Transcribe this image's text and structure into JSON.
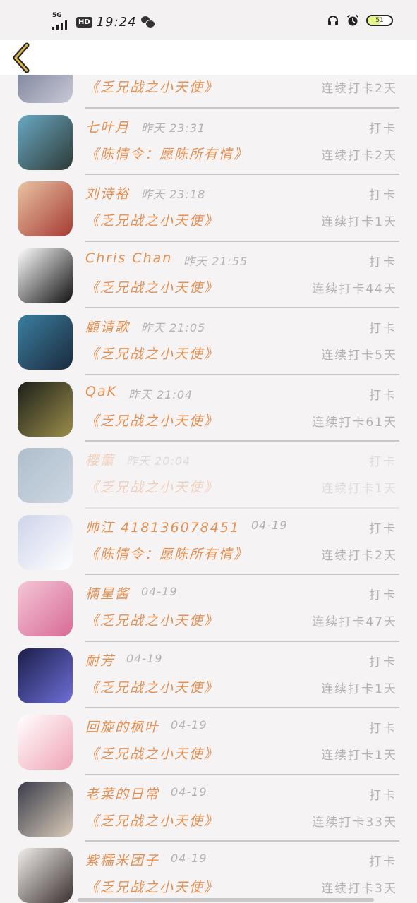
{
  "status_bar": {
    "network": "5G",
    "hd": "HD",
    "time": "19:24",
    "battery": "51",
    "battery_level": 0.51
  },
  "header": {
    "back_icon": "chevron-left-icon",
    "accent": "#d8b24a"
  },
  "rows": [
    {
      "name": "",
      "time": "",
      "action": "",
      "book": "《乏兄战之小天使》",
      "streak": "连续打卡2天",
      "avatar_colors": [
        "#6e7690",
        "#c8c9d6"
      ]
    },
    {
      "name": "七叶月",
      "time": "昨天 23:31",
      "action": "打卡",
      "book": "《陈情令：愿陈所有情》",
      "streak": "连续打卡2天",
      "avatar_colors": [
        "#6aa9c4",
        "#2d3a36"
      ]
    },
    {
      "name": "刘诗裕",
      "time": "昨天 23:18",
      "action": "打卡",
      "book": "《乏兄战之小天使》",
      "streak": "连续打卡1天",
      "avatar_colors": [
        "#e9c4a5",
        "#a63a32"
      ]
    },
    {
      "name": "Chris Chan",
      "time": "昨天 21:55",
      "action": "打卡",
      "book": "《乏兄战之小天使》",
      "streak": "连续打卡44天",
      "avatar_colors": [
        "#ffffff",
        "#111111"
      ]
    },
    {
      "name": "顧请歌",
      "time": "昨天 21:05",
      "action": "打卡",
      "book": "《乏兄战之小天使》",
      "streak": "连续打卡5天",
      "avatar_colors": [
        "#3b7fa0",
        "#1b2a3d"
      ]
    },
    {
      "name": "QaK",
      "time": "昨天 21:04",
      "action": "打卡",
      "book": "《乏兄战之小天使》",
      "streak": "连续打卡61天",
      "avatar_colors": [
        "#1b1f1a",
        "#9b8d4a"
      ]
    },
    {
      "name": "櫻薰",
      "time": "昨天 20:04",
      "action": "打卡",
      "book": "《乏兄战之小天使》",
      "streak": "连续打卡1天",
      "avatar_colors": [
        "#2f5a7e",
        "#7fa8c4"
      ],
      "faded": true
    },
    {
      "name": "帅江 418136078451",
      "time": "04-19",
      "action": "打卡",
      "book": "《陈情令：愿陈所有情》",
      "streak": "连续打卡2天",
      "avatar_colors": [
        "#cdd3ea",
        "#ffffff"
      ]
    },
    {
      "name": "楠星酱",
      "time": "04-19",
      "action": "打卡",
      "book": "《乏兄战之小天使》",
      "streak": "连续打卡47天",
      "avatar_colors": [
        "#f4c6d6",
        "#d86a96"
      ]
    },
    {
      "name": "耐芳",
      "time": "04-19",
      "action": "打卡",
      "book": "《乏兄战之小天使》",
      "streak": "连续打卡1天",
      "avatar_colors": [
        "#1b1d4a",
        "#6e6fd6"
      ]
    },
    {
      "name": "回旋的枫叶",
      "time": "04-19",
      "action": "打卡",
      "book": "《乏兄战之小天使》",
      "streak": "连续打卡1天",
      "avatar_colors": [
        "#ffffff",
        "#f0a3b5"
      ]
    },
    {
      "name": "老菜的日常",
      "time": "04-19",
      "action": "打卡",
      "book": "《乏兄战之小天使》",
      "streak": "连续打卡33天",
      "avatar_colors": [
        "#3a3b4a",
        "#d9cbb8"
      ]
    },
    {
      "name": "紫糯米团子",
      "time": "04-19",
      "action": "打卡",
      "book": "《乏兄战之小天使》",
      "streak": "连续打卡3天",
      "avatar_colors": [
        "#f2eeea",
        "#3a3130"
      ]
    }
  ]
}
